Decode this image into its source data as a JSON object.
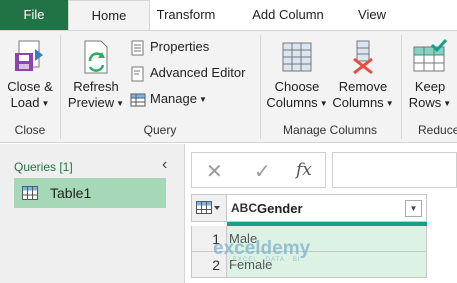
{
  "tabs": {
    "file": "File",
    "home": "Home",
    "transform": "Transform",
    "add_column": "Add Column",
    "view": "View"
  },
  "ribbon": {
    "close_group": {
      "label": "Close",
      "close_load_line1": "Close &",
      "close_load_line2": "Load"
    },
    "query_group": {
      "label": "Query",
      "refresh_line1": "Refresh",
      "refresh_line2": "Preview",
      "properties": "Properties",
      "advanced_editor": "Advanced Editor",
      "manage": "Manage"
    },
    "manage_columns_group": {
      "label": "Manage Columns",
      "choose_line1": "Choose",
      "choose_line2": "Columns",
      "remove_line1": "Remove",
      "remove_line2": "Columns"
    },
    "reduce_group": {
      "label": "Reduce",
      "keep_line1": "Keep",
      "keep_line2": "Rows"
    }
  },
  "queries_pane": {
    "title": "Queries [1]",
    "items": [
      {
        "label": "Table1"
      }
    ]
  },
  "formula_bar": {
    "fx": "fx",
    "value": ""
  },
  "grid": {
    "column_type": "ABC",
    "column_name": "Gender",
    "rows": [
      {
        "num": "1",
        "value": "Male"
      },
      {
        "num": "2",
        "value": "Female"
      }
    ]
  },
  "watermark": {
    "name": "exceldemy",
    "tagline": "EXCEL · DATA · BI"
  },
  "colors": {
    "file_tab": "#217346",
    "selected_query": "#a6d8b8",
    "column_accent": "#16a085",
    "cell_bg": "#dcf2e4"
  }
}
